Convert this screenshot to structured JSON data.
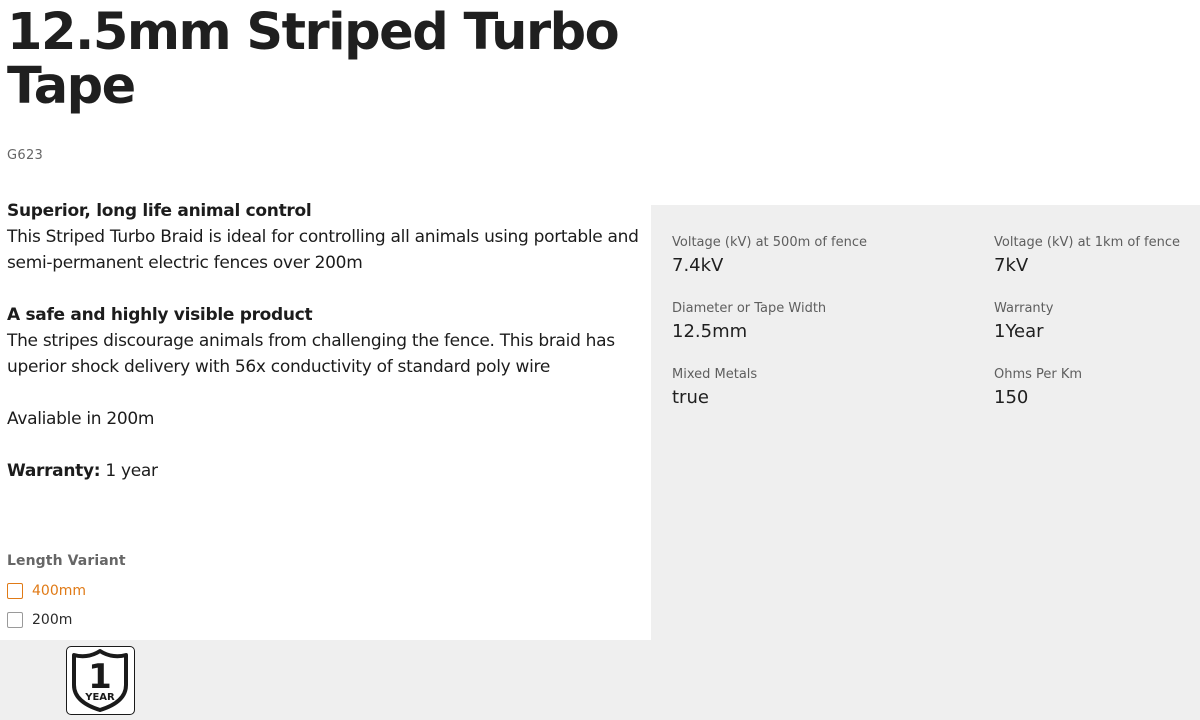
{
  "product": {
    "title": "12.5mm Striped Turbo Tape",
    "sku": "G623"
  },
  "description": {
    "heading1": "Superior, long life animal control",
    "para1": "This Striped Turbo Braid is ideal for controlling all animals using portable and semi-permanent electric fences over 200m",
    "heading2": "A safe and highly visible product",
    "para2": "The stripes discourage animals from challenging the fence. This braid has uperior shock delivery with 56x conductivity of standard poly wire",
    "availability": "Avaliable in 200m",
    "warranty_label": "Warranty:",
    "warranty_value": " 1 year"
  },
  "variants": {
    "label": "Length Variant",
    "options": [
      {
        "label": "400mm",
        "selected": true
      },
      {
        "label": "200m",
        "selected": false
      }
    ]
  },
  "specs": [
    {
      "label": "Voltage (kV) at 500m of fence",
      "value": "7.4kV"
    },
    {
      "label": "Voltage (kV) at 1km of fence",
      "value": "7kV"
    },
    {
      "label": "Diameter or Tape Width",
      "value": "12.5mm"
    },
    {
      "label": "Warranty",
      "value": "1Year"
    },
    {
      "label": "Mixed Metals",
      "value": "true"
    },
    {
      "label": "Ohms Per Km",
      "value": "150"
    }
  ],
  "badge": {
    "icon": "warranty-shield-icon",
    "number": "1",
    "text": "YEAR"
  },
  "colors": {
    "accent": "#e07a16",
    "panel": "#efefef",
    "text": "#1c1c1c",
    "muted": "#5e5e5e"
  }
}
